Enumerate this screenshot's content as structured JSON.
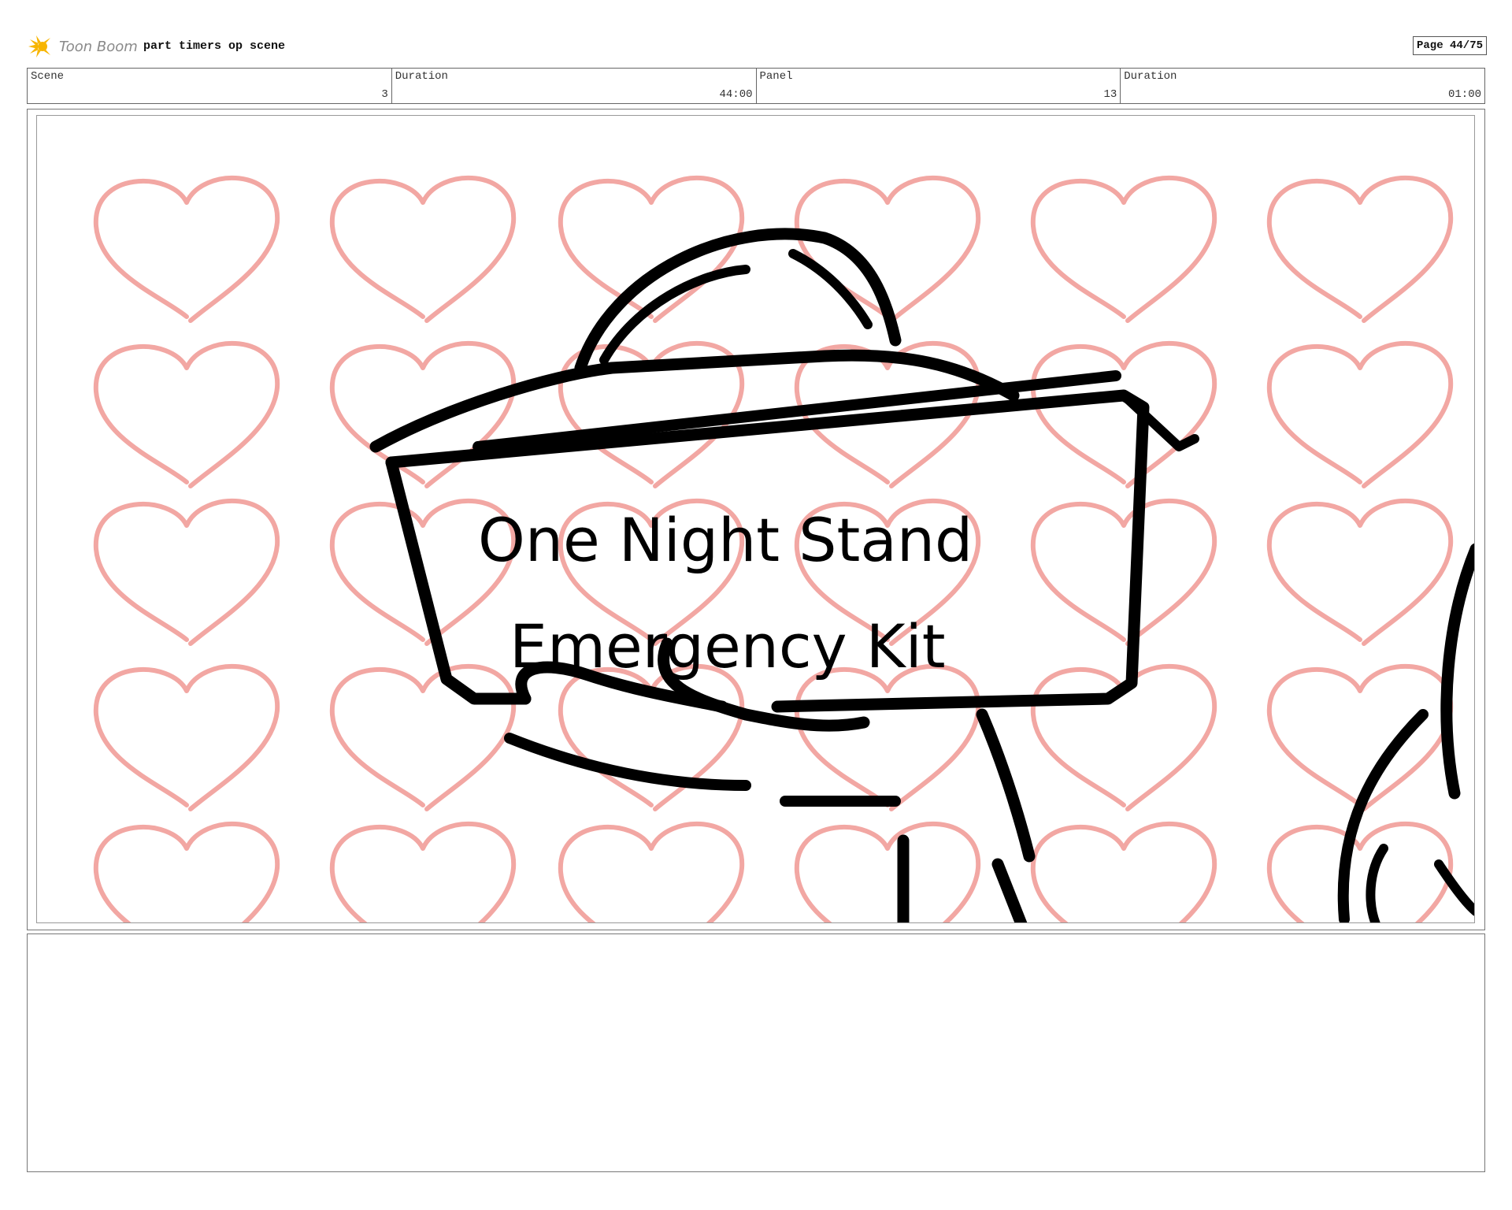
{
  "header": {
    "brand": "Toon Boom",
    "project_title": "part timers op scene",
    "page_label": "Page 44/75"
  },
  "info": {
    "scene_label": "Scene",
    "scene_value": "3",
    "scene_duration_label": "Duration",
    "scene_duration_value": "44:00",
    "panel_label": "Panel",
    "panel_value": "13",
    "panel_duration_label": "Duration",
    "panel_duration_value": "01:00"
  },
  "drawing": {
    "sign_line_1": "One Night Stand",
    "sign_line_2": "Emergency Kit",
    "heart_color": "#f2a7a3",
    "ink_color": "#000000"
  },
  "notes": {
    "text": ""
  }
}
